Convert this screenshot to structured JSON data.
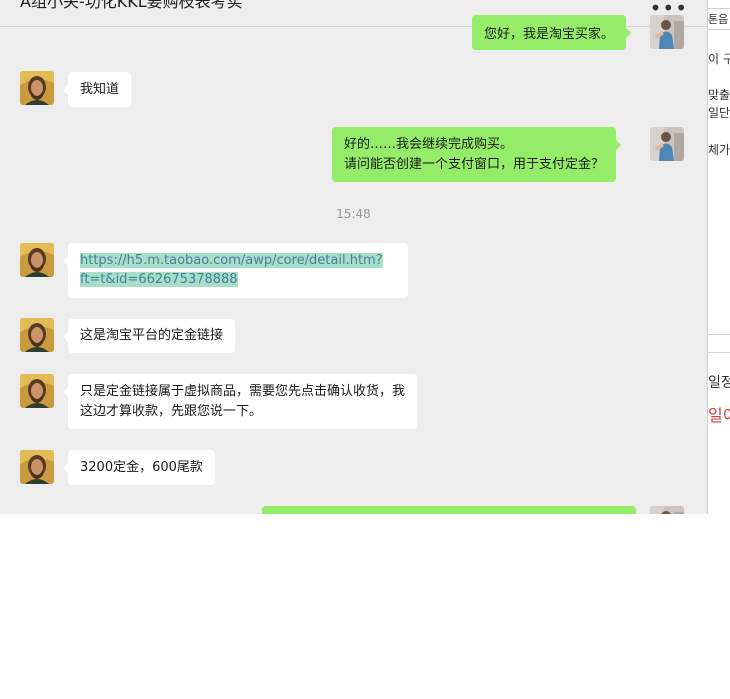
{
  "chat": {
    "title": "A组小关-功化KKL要购枝表考实",
    "more_label": "•••",
    "timestamp": "15:48",
    "messages": [
      {
        "sender": "self",
        "lines": [
          "您好，我是淘宝买家。"
        ]
      },
      {
        "sender": "other",
        "lines": [
          "我知道"
        ]
      },
      {
        "sender": "self",
        "lines": [
          "好的……我会继续完成购买。",
          "请问能否创建一个支付窗口，用于支付定金？"
        ]
      },
      {
        "sender": "other",
        "type": "link",
        "lines": [
          "https://h5.m.taobao.com/awp/core/detail.htm?",
          "ft=t&id=662675378888"
        ]
      },
      {
        "sender": "other",
        "lines": [
          "这是淘宝平台的定金链接"
        ]
      },
      {
        "sender": "other",
        "lines": [
          "只是定金链接属于虚拟商品，需要您先点击确认收货，我",
          "这边才算收款，先跟您说一下。"
        ]
      },
      {
        "sender": "other",
        "lines": [
          "3200定金，600尾款"
        ]
      },
      {
        "sender": "self",
        "lines": [
          ""
        ]
      }
    ]
  },
  "right_panel": {
    "items": [
      "톤음",
      "이 구",
      "맞출",
      "일단",
      "체가",
      "일정",
      "일이"
    ]
  },
  "colors": {
    "self_bubble": "#95ec69",
    "other_bubble": "#ffffff",
    "chat_bg": "#ededed",
    "link_highlight": "#a6dfc8",
    "link_text": "#4a7f9c",
    "right_panel_red": "#d23c3c"
  }
}
